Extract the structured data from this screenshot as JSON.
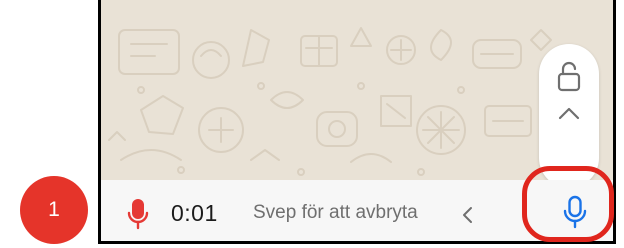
{
  "step": {
    "number": "1",
    "color": "#e5342a"
  },
  "recording": {
    "timer": "0:01",
    "swipe_hint": "Svep för att avbryta",
    "mic_color": "#e53935",
    "send_mic_color": "#1a73e8"
  },
  "lock": {
    "icon": "lock-open-icon",
    "chevron": "chevron-up-icon"
  },
  "highlight": {
    "color": "#e0261d"
  }
}
